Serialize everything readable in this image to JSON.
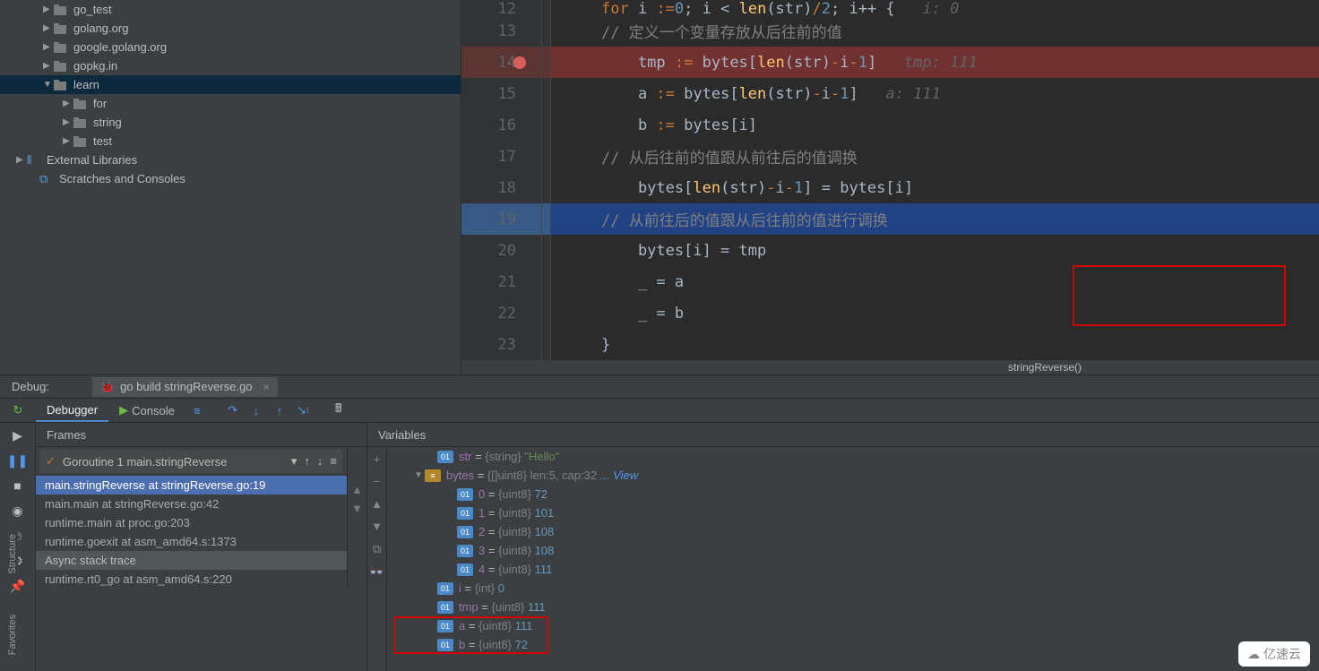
{
  "project_tree": {
    "items": [
      {
        "indent": 48,
        "arrow": "▶",
        "icon": "folder",
        "label": "go_test"
      },
      {
        "indent": 48,
        "arrow": "▶",
        "icon": "folder",
        "label": "golang.org"
      },
      {
        "indent": 48,
        "arrow": "▶",
        "icon": "folder",
        "label": "google.golang.org"
      },
      {
        "indent": 48,
        "arrow": "▶",
        "icon": "folder",
        "label": "gopkg.in"
      },
      {
        "indent": 48,
        "arrow": "▼",
        "icon": "folder",
        "label": "learn",
        "selected": true
      },
      {
        "indent": 70,
        "arrow": "▶",
        "icon": "folder",
        "label": "for"
      },
      {
        "indent": 70,
        "arrow": "▶",
        "icon": "folder",
        "label": "string"
      },
      {
        "indent": 70,
        "arrow": "▶",
        "icon": "folder",
        "label": "test"
      },
      {
        "indent": 18,
        "arrow": "▶",
        "icon": "lib",
        "label": "External Libraries"
      },
      {
        "indent": 32,
        "arrow": "",
        "icon": "scratches",
        "label": "Scratches and Consoles"
      }
    ]
  },
  "editor": {
    "breadcrumb": "stringReverse()",
    "lines": [
      {
        "n": 12,
        "html": "<span class='kw'>for</span> i <span class='kw'>:=</span> <span class='num'>0</span>; i &lt; <span class='fn'>len</span>(str)<span class='kw'>/</span><span class='num'>2</span>; i++ {   <span class='annot'>i: 0</span>",
        "cls": ""
      },
      {
        "n": 13,
        "html": "    <span class='cmt'>// 定义一个变量存放从后往前的值</span>",
        "cls": ""
      },
      {
        "n": 14,
        "html": "    tmp <span class='kw'>:=</span> bytes[<span class='fn'>len</span>(str)<span class='kw'>-</span>i<span class='kw'>-</span><span class='num'>1</span>]   <span class='annot'>tmp: 111</span>",
        "cls": "break-line",
        "bp": true
      },
      {
        "n": 15,
        "html": "    a <span class='kw'>:=</span> bytes[<span class='fn'>len</span>(str)<span class='kw'>-</span>i<span class='kw'>-</span><span class='num'>1</span>]   <span class='annot'>a: 111</span>",
        "cls": ""
      },
      {
        "n": 16,
        "html": "    b <span class='kw'>:=</span> bytes[i]",
        "cls": ""
      },
      {
        "n": 17,
        "html": "    <span class='cmt'>// 从后往前的值跟从前往后的值调换</span>",
        "cls": ""
      },
      {
        "n": 18,
        "html": "    bytes[<span class='fn'>len</span>(str)<span class='kw'>-</span>i<span class='kw'>-</span><span class='num'>1</span>] = bytes[i]",
        "cls": ""
      },
      {
        "n": 19,
        "html": "    <span class='cmt'>// 从前往后的值跟从后往前的值进行调换</span>",
        "cls": "current"
      },
      {
        "n": 20,
        "html": "    bytes[i] = tmp",
        "cls": ""
      },
      {
        "n": 21,
        "html": "    _ = a",
        "cls": ""
      },
      {
        "n": 22,
        "html": "    _ = b",
        "cls": ""
      },
      {
        "n": 23,
        "html": "}",
        "cls": ""
      }
    ]
  },
  "debug": {
    "title": "Debug:",
    "buildTab": "go build stringReverse.go",
    "tabs": {
      "debugger": "Debugger",
      "console": "Console"
    },
    "frames": {
      "header": "Frames",
      "goroutine": "Goroutine 1 main.stringReverse",
      "stack": [
        {
          "text": "main.stringReverse at stringReverse.go:19",
          "sel": true
        },
        {
          "text": "main.main at stringReverse.go:42"
        },
        {
          "text": "runtime.main at proc.go:203"
        },
        {
          "text": "runtime.goexit at asm_amd64.s:1373"
        }
      ],
      "asyncHeader": "Async stack trace",
      "async": [
        {
          "text": "runtime.rt0_go at asm_amd64.s:220"
        }
      ]
    },
    "variables": {
      "header": "Variables",
      "rows": [
        {
          "indent": 14,
          "arrow": "",
          "icon": "01",
          "name": "str",
          "type": "{string}",
          "val": "\"Hello\"",
          "valcls": "vstr"
        },
        {
          "indent": 0,
          "arrow": "▼",
          "icon": "≡",
          "name": "bytes",
          "type": "{[]uint8} len:5, cap:32",
          "val": "... View",
          "valcls": "vlink",
          "iconcls": "yellow"
        },
        {
          "indent": 36,
          "arrow": "",
          "icon": "01",
          "name": "0",
          "type": "{uint8}",
          "val": "72"
        },
        {
          "indent": 36,
          "arrow": "",
          "icon": "01",
          "name": "1",
          "type": "{uint8}",
          "val": "101"
        },
        {
          "indent": 36,
          "arrow": "",
          "icon": "01",
          "name": "2",
          "type": "{uint8}",
          "val": "108"
        },
        {
          "indent": 36,
          "arrow": "",
          "icon": "01",
          "name": "3",
          "type": "{uint8}",
          "val": "108"
        },
        {
          "indent": 36,
          "arrow": "",
          "icon": "01",
          "name": "4",
          "type": "{uint8}",
          "val": "111"
        },
        {
          "indent": 14,
          "arrow": "",
          "icon": "01",
          "name": "i",
          "type": "{int}",
          "val": "0"
        },
        {
          "indent": 14,
          "arrow": "",
          "icon": "01",
          "name": "tmp",
          "type": "{uint8}",
          "val": "111"
        },
        {
          "indent": 14,
          "arrow": "",
          "icon": "01",
          "name": "a",
          "type": "{uint8}",
          "val": "111"
        },
        {
          "indent": 14,
          "arrow": "",
          "icon": "01",
          "name": "b",
          "type": "{uint8}",
          "val": "72"
        }
      ]
    }
  },
  "sideTabs": {
    "structure": "Structure",
    "favorites": "Favorites"
  },
  "watermark": "亿速云"
}
